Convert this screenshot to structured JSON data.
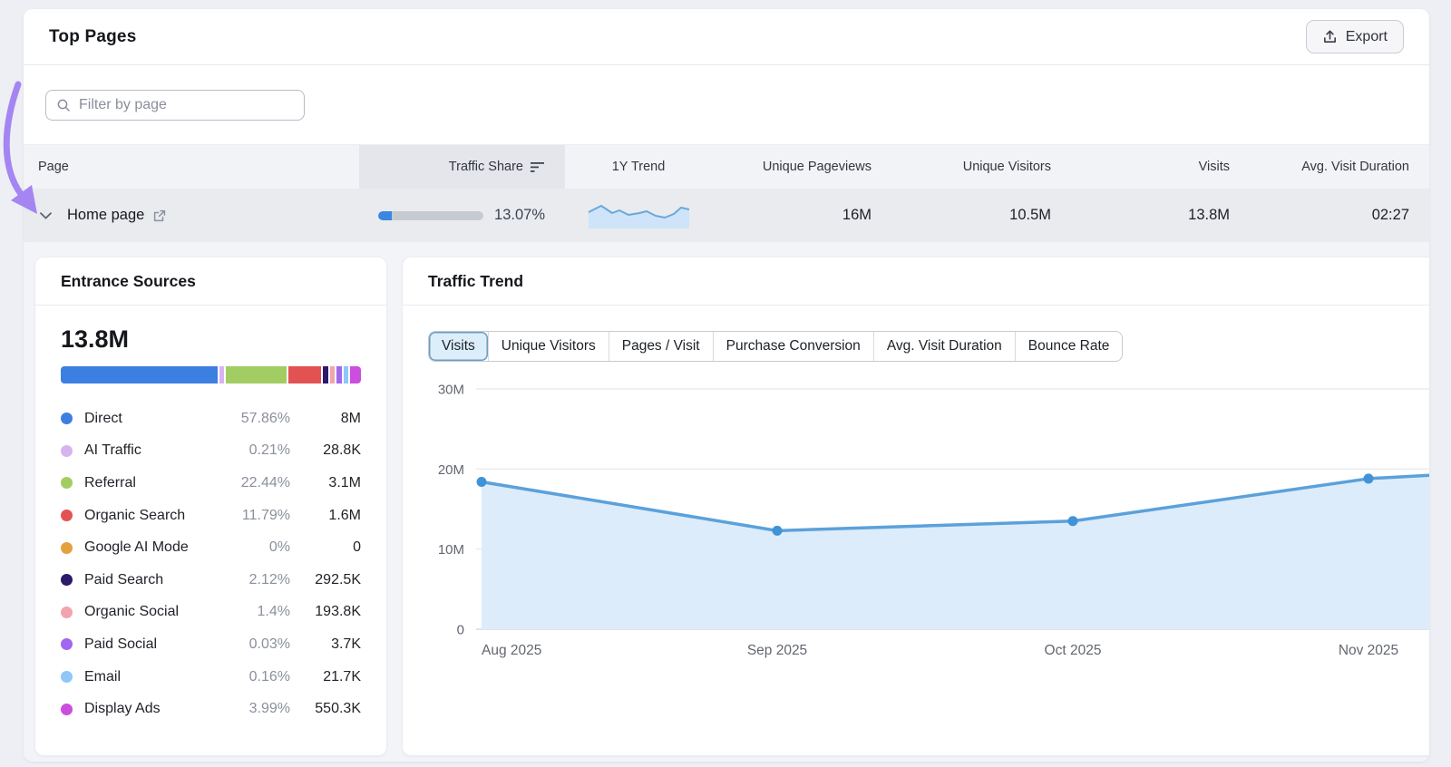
{
  "header": {
    "title": "Top Pages",
    "export_label": "Export"
  },
  "filter": {
    "placeholder": "Filter by page"
  },
  "table": {
    "columns": [
      {
        "label": "Page"
      },
      {
        "label": "Traffic Share",
        "sorted": true
      },
      {
        "label": "1Y Trend"
      },
      {
        "label": "Unique Pageviews"
      },
      {
        "label": "Unique Visitors"
      },
      {
        "label": "Visits"
      },
      {
        "label": "Avg. Visit Duration"
      }
    ],
    "row": {
      "page": "Home page",
      "traffic_share": "13.07%",
      "traffic_share_pct": 13.07,
      "unique_pageviews": "16M",
      "unique_visitors": "10.5M",
      "visits": "13.8M",
      "avg_visit_duration": "02:27",
      "share_fill_color": "#3b87e0",
      "sparkline_points": [
        [
          0,
          10
        ],
        [
          14,
          3
        ],
        [
          26,
          11
        ],
        [
          34,
          8
        ],
        [
          44,
          13
        ],
        [
          56,
          11
        ],
        [
          64,
          9
        ],
        [
          74,
          14
        ],
        [
          84,
          16
        ],
        [
          94,
          12
        ],
        [
          102,
          5
        ],
        [
          111,
          7
        ]
      ],
      "sparkline_line_color": "#68a9dd",
      "sparkline_fill_color": "#cfe4f8"
    }
  },
  "entrance": {
    "title": "Entrance Sources",
    "total": "13.8M",
    "sources": [
      {
        "label": "Direct",
        "percent": "57.86%",
        "share": 57.86,
        "value": "8M",
        "color": "#3d7fe0"
      },
      {
        "label": "AI Traffic",
        "percent": "0.21%",
        "share": 0.21,
        "value": "28.8K",
        "color": "#d9b3f0"
      },
      {
        "label": "Referral",
        "percent": "22.44%",
        "share": 22.44,
        "value": "3.1M",
        "color": "#a2cd63"
      },
      {
        "label": "Organic Search",
        "percent": "11.79%",
        "share": 11.79,
        "value": "1.6M",
        "color": "#e35252"
      },
      {
        "label": "Google AI Mode",
        "percent": "0%",
        "share": 0,
        "value": "0",
        "color": "#e2a23e"
      },
      {
        "label": "Paid Search",
        "percent": "2.12%",
        "share": 2.12,
        "value": "292.5K",
        "color": "#2c1a6b"
      },
      {
        "label": "Organic Social",
        "percent": "1.4%",
        "share": 1.4,
        "value": "193.8K",
        "color": "#f2a4ae"
      },
      {
        "label": "Paid Social",
        "percent": "0.03%",
        "share": 0.03,
        "value": "3.7K",
        "color": "#a266ef"
      },
      {
        "label": "Email",
        "percent": "0.16%",
        "share": 0.16,
        "value": "21.7K",
        "color": "#8fc7f6"
      },
      {
        "label": "Display Ads",
        "percent": "3.99%",
        "share": 3.99,
        "value": "550.3K",
        "color": "#cb4ede"
      }
    ]
  },
  "traffic_trend": {
    "title": "Traffic Trend",
    "tabs": [
      {
        "label": "Visits",
        "selected": true
      },
      {
        "label": "Unique Visitors",
        "selected": false
      },
      {
        "label": "Pages / Visit",
        "selected": false
      },
      {
        "label": "Purchase Conversion",
        "selected": false
      },
      {
        "label": "Avg. Visit Duration",
        "selected": false
      },
      {
        "label": "Bounce Rate",
        "selected": false
      }
    ]
  },
  "chart_data": [
    {
      "type": "area",
      "title": "Traffic Trend",
      "metric": "Visits",
      "x": [
        "Aug 2025",
        "Sep 2025",
        "Oct 2025",
        "Nov 2025"
      ],
      "values_millions": [
        18.4,
        12.3,
        13.5,
        18.8
      ],
      "edge_value_millions": 19.4,
      "ylim_millions": [
        0,
        30
      ],
      "yticks": [
        {
          "label": "30M",
          "value": 30
        },
        {
          "label": "20M",
          "value": 20
        },
        {
          "label": "10M",
          "value": 10
        },
        {
          "label": "0",
          "value": 0
        }
      ],
      "grid": "horizontal",
      "legend": "none",
      "line_color": "#5ba1db",
      "point_color": "#3f93d6",
      "fill_color": "#ddecfa",
      "grid_color": "#e9ebee",
      "zero_line_color": "#d9dce1",
      "axis_text_color": "#62666f"
    },
    {
      "type": "stacked-bar",
      "title": "Entrance Sources",
      "total_label": "13.8M",
      "categories": [
        "Direct",
        "AI Traffic",
        "Referral",
        "Organic Search",
        "Google AI Mode",
        "Paid Search",
        "Organic Social",
        "Paid Social",
        "Email",
        "Display Ads"
      ],
      "percents": [
        57.86,
        0.21,
        22.44,
        11.79,
        0,
        2.12,
        1.4,
        0.03,
        0.16,
        3.99
      ],
      "value_labels": [
        "8M",
        "28.8K",
        "3.1M",
        "1.6M",
        "0",
        "292.5K",
        "193.8K",
        "3.7K",
        "21.7K",
        "550.3K"
      ],
      "colors": [
        "#3d7fe0",
        "#d9b3f0",
        "#a2cd63",
        "#e35252",
        "#e2a23e",
        "#2c1a6b",
        "#f2a4ae",
        "#a266ef",
        "#8fc7f6",
        "#cb4ede"
      ]
    },
    {
      "type": "line",
      "title": "1Y Trend sparkline (Home page row)",
      "normalized_points": [
        [
          0,
          10
        ],
        [
          14,
          3
        ],
        [
          26,
          11
        ],
        [
          34,
          8
        ],
        [
          44,
          13
        ],
        [
          56,
          11
        ],
        [
          64,
          9
        ],
        [
          74,
          14
        ],
        [
          84,
          16
        ],
        [
          94,
          12
        ],
        [
          102,
          5
        ],
        [
          111,
          7
        ]
      ]
    }
  ],
  "annotation": {
    "shape": "curved-arrow",
    "color": "#a585f1"
  }
}
